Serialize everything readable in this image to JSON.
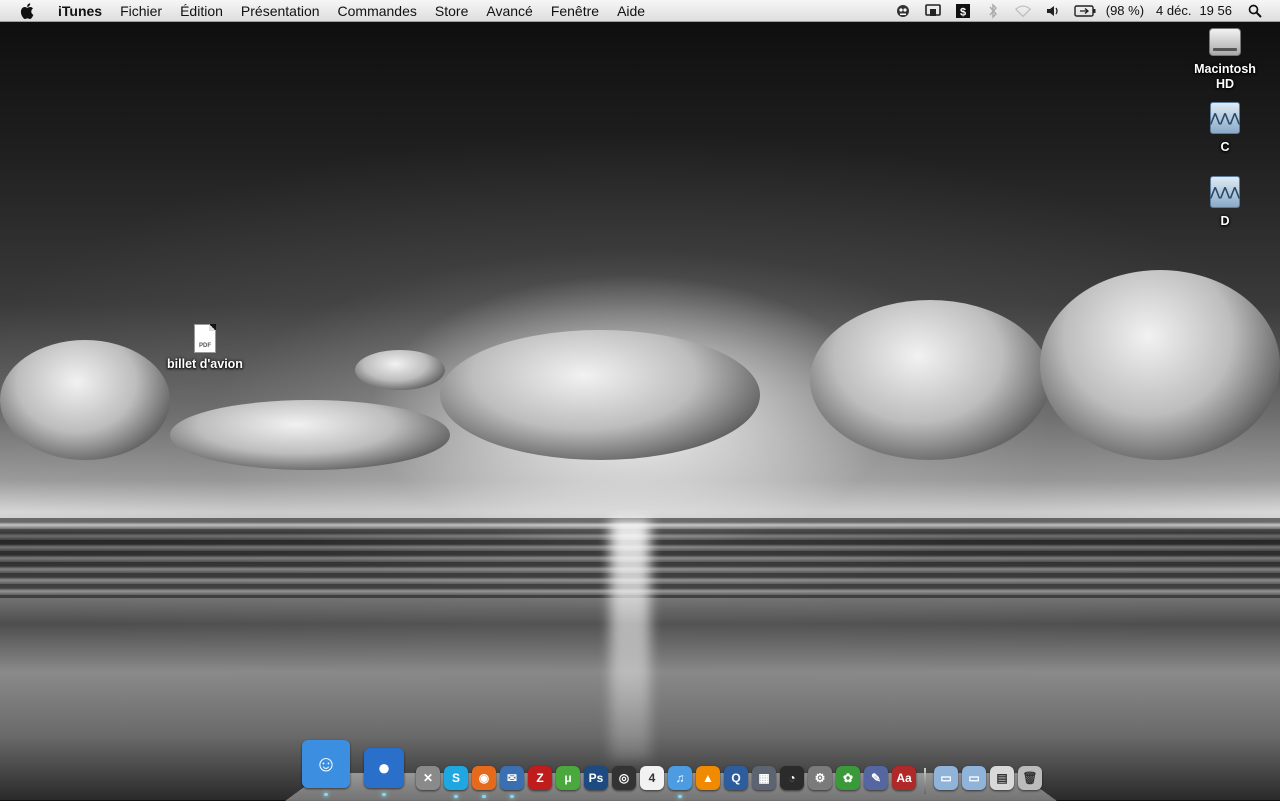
{
  "menubar": {
    "apple_icon": "apple-logo-icon",
    "app_name": "iTunes",
    "menus": [
      "Fichier",
      "Édition",
      "Présentation",
      "Commandes",
      "Store",
      "Avancé",
      "Fenêtre",
      "Aide"
    ],
    "status": {
      "battery_percent": "(98 %)",
      "date": "4 déc.",
      "time": "19 56"
    },
    "status_icons": [
      "growl-icon",
      "airplay-icon",
      "script-icon",
      "bluetooth-icon",
      "wifi-icon",
      "volume-icon",
      "battery-icon",
      "spotlight-icon"
    ]
  },
  "desktop": {
    "icons": [
      {
        "label": "Macintosh HD",
        "icon": "hard-drive-icon"
      },
      {
        "label": "C",
        "icon": "network-volume-icon"
      },
      {
        "label": "D",
        "icon": "network-volume-icon"
      },
      {
        "label": "billet d'avion",
        "icon": "pdf-file-icon",
        "badge": "PDF"
      }
    ]
  },
  "dock": {
    "apps": [
      {
        "name": "finder-icon",
        "running": true,
        "glyph": "☺",
        "color": "#3c8fe0"
      },
      {
        "name": "adium-icon",
        "running": true,
        "glyph": "●",
        "color": "#2a6fc9"
      },
      {
        "name": "utility-icon",
        "running": false,
        "glyph": "✕",
        "color": "#8a8a8a"
      },
      {
        "name": "skype-icon",
        "running": true,
        "glyph": "S",
        "color": "#1ea7e1"
      },
      {
        "name": "firefox-icon",
        "running": true,
        "glyph": "◉",
        "color": "#e66a1c"
      },
      {
        "name": "thunderbird-icon",
        "running": true,
        "glyph": "✉",
        "color": "#3a6fb2"
      },
      {
        "name": "filezilla-icon",
        "running": false,
        "glyph": "Z",
        "color": "#bf1d1d"
      },
      {
        "name": "utorrent-icon",
        "running": false,
        "glyph": "μ",
        "color": "#4aa93c"
      },
      {
        "name": "photoshop-icon",
        "running": false,
        "glyph": "Ps",
        "color": "#1d4a80"
      },
      {
        "name": "dvd-player-icon",
        "running": false,
        "glyph": "◎",
        "color": "#333"
      },
      {
        "name": "calendar-icon",
        "running": false,
        "glyph": "4",
        "color": "#f2f2f2"
      },
      {
        "name": "itunes-icon",
        "running": true,
        "glyph": "♫",
        "color": "#4d9be0"
      },
      {
        "name": "vlc-icon",
        "running": false,
        "glyph": "▲",
        "color": "#f08a00"
      },
      {
        "name": "quicktime-icon",
        "running": false,
        "glyph": "Q",
        "color": "#2d5d9c"
      },
      {
        "name": "exposé-icon",
        "running": false,
        "glyph": "▦",
        "color": "#5b6470"
      },
      {
        "name": "dashboard-icon",
        "running": false,
        "glyph": "◔",
        "color": "#2b2b2b"
      },
      {
        "name": "system-preferences-icon",
        "running": false,
        "glyph": "⚙",
        "color": "#7b7b7b"
      },
      {
        "name": "plant-app-icon",
        "running": false,
        "glyph": "✿",
        "color": "#3a9a3a"
      },
      {
        "name": "script-editor-icon",
        "running": false,
        "glyph": "✎",
        "color": "#5566a0"
      },
      {
        "name": "dictionary-icon",
        "running": false,
        "glyph": "Aa",
        "color": "#b02828"
      }
    ],
    "stacks": [
      {
        "name": "applications-stack-icon",
        "glyph": "▭",
        "color": "#8fb3d9"
      },
      {
        "name": "documents-stack-icon",
        "glyph": "▭",
        "color": "#8fb3d9"
      },
      {
        "name": "downloads-stack-icon",
        "glyph": "▤",
        "color": "#d9d9d9"
      },
      {
        "name": "trash-icon",
        "glyph": "🗑",
        "color": "#bbb"
      }
    ]
  }
}
